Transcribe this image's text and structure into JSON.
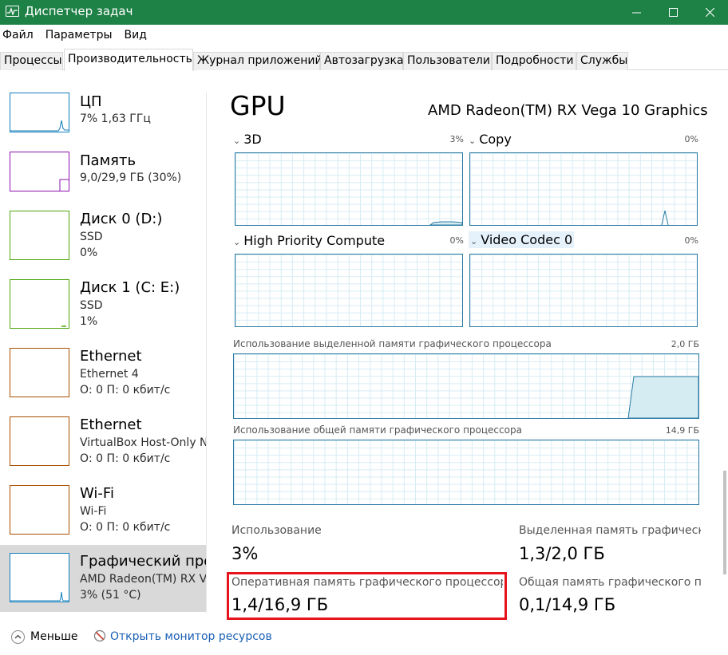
{
  "window": {
    "title": "Диспетчер задач",
    "minimize_icon": "minimize-icon",
    "maximize_icon": "maximize-icon",
    "close_icon": "close-icon",
    "title_color": "#1e8146"
  },
  "menu": [
    "Файл",
    "Параметры",
    "Вид"
  ],
  "tabs": [
    {
      "label": "Процессы",
      "active": false
    },
    {
      "label": "Производительность",
      "active": true
    },
    {
      "label": "Журнал приложений",
      "active": false
    },
    {
      "label": "Автозагрузка",
      "active": false
    },
    {
      "label": "Пользователи",
      "active": false
    },
    {
      "label": "Подробности",
      "active": false
    },
    {
      "label": "Службы",
      "active": false
    }
  ],
  "sidebar": [
    {
      "title": "ЦП",
      "line2": "7%  1,63 ГГц",
      "line3": "",
      "color": "#117dbb"
    },
    {
      "title": "Память",
      "line2": "9,0/29,9 ГБ (30%)",
      "line3": "",
      "color": "#8b12ae"
    },
    {
      "title": "Диск 0 (D:)",
      "line2": "SSD",
      "line3": "0%",
      "color": "#4da60c"
    },
    {
      "title": "Диск 1 (C: E:)",
      "line2": "SSD",
      "line3": "1%",
      "color": "#4da60c"
    },
    {
      "title": "Ethernet",
      "line2": "Ethernet 4",
      "line3": "О: 0 П: 0 кбит/с",
      "color": "#a74f01"
    },
    {
      "title": "Ethernet",
      "line2": "VirtualBox Host-Only Ne",
      "line3": "О: 0 П: 0 кбит/с",
      "color": "#a74f01"
    },
    {
      "title": "Wi-Fi",
      "line2": "Wi-Fi",
      "line3": "О: 0 П: 0 кбит/с",
      "color": "#a74f01"
    },
    {
      "title": "Графический проц",
      "line2": "AMD Radeon(TM) RX Ve",
      "line3": "3%  (51 °C)",
      "color": "#117dbb"
    }
  ],
  "main": {
    "title": "GPU",
    "device_name": "AMD Radeon(TM) RX Vega 10 Graphics",
    "engines": [
      {
        "name": "3D",
        "percent": "3%"
      },
      {
        "name": "Copy",
        "percent": "0%"
      },
      {
        "name": "High Priority Compute",
        "percent": "0%"
      },
      {
        "name": "Video Codec 0",
        "percent": "0%"
      }
    ],
    "dedicated_graph": {
      "label": "Использование выделенной памяти графического процессора",
      "max": "2,0 ГБ"
    },
    "shared_graph": {
      "label": "Использование общей памяти графического процессора",
      "max": "14,9 ГБ"
    },
    "stats": {
      "usage_label": "Использование",
      "usage_value": "3%",
      "dedicated_label": "Выделенная память графическо",
      "dedicated_value": "1,3/2,0 ГБ",
      "gpu_mem_label": "Оперативная память графического процессора",
      "gpu_mem_value": "1,4/16,9 ГБ",
      "shared_label": "Общая память графического про",
      "shared_value": "0,1/14,9 ГБ"
    },
    "highlight_color": "#e5141b",
    "graph_color": "#2b7ba3"
  },
  "footer": {
    "fewer_label": "Меньше",
    "fewer_icon": "chevron-up-icon",
    "resmon_label": "Открыть монитор ресурсов",
    "resmon_icon": "resource-monitor-icon"
  }
}
